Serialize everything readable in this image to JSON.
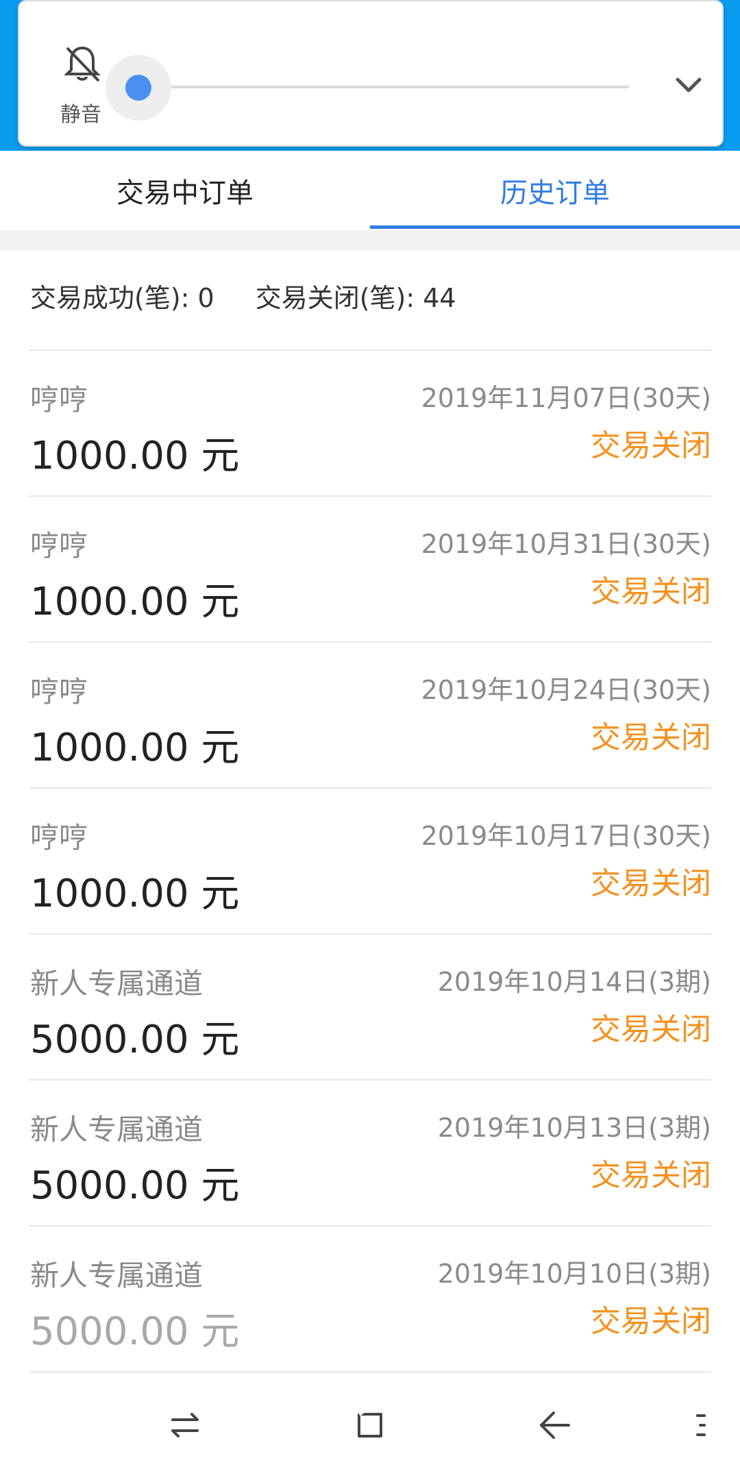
{
  "volume": {
    "mute_label": "静音",
    "level_fraction": 0.0,
    "accent_color": "#4a90f0"
  },
  "tabs": [
    {
      "label": "交易中订单",
      "active": false
    },
    {
      "label": "历史订单",
      "active": true
    }
  ],
  "summary": {
    "success_text": "交易成功(笔): 0",
    "closed_text": "交易关闭(笔): 44"
  },
  "orders": [
    {
      "name": "哼哼",
      "amount": "1000.00 元",
      "date": "2019年11月07日(30天)",
      "status": "交易关闭"
    },
    {
      "name": "哼哼",
      "amount": "1000.00 元",
      "date": "2019年10月31日(30天)",
      "status": "交易关闭"
    },
    {
      "name": "哼哼",
      "amount": "1000.00 元",
      "date": "2019年10月24日(30天)",
      "status": "交易关闭"
    },
    {
      "name": "哼哼",
      "amount": "1000.00 元",
      "date": "2019年10月17日(30天)",
      "status": "交易关闭"
    },
    {
      "name": "新人专属通道",
      "amount": "5000.00 元",
      "date": "2019年10月14日(3期)",
      "status": "交易关闭"
    },
    {
      "name": "新人专属通道",
      "amount": "5000.00 元",
      "date": "2019年10月13日(3期)",
      "status": "交易关闭"
    },
    {
      "name": "新人专属通道",
      "amount": "5000.00 元",
      "date": "2019年10月10日(3期)",
      "status": "交易关闭"
    }
  ],
  "colors": {
    "header_blue": "#0a9cf0",
    "tab_active": "#2f7be5",
    "status_orange": "#f39220"
  },
  "navbar": {
    "icons": [
      "recent-apps-icon",
      "home-icon",
      "back-icon",
      "menu-icon"
    ]
  }
}
